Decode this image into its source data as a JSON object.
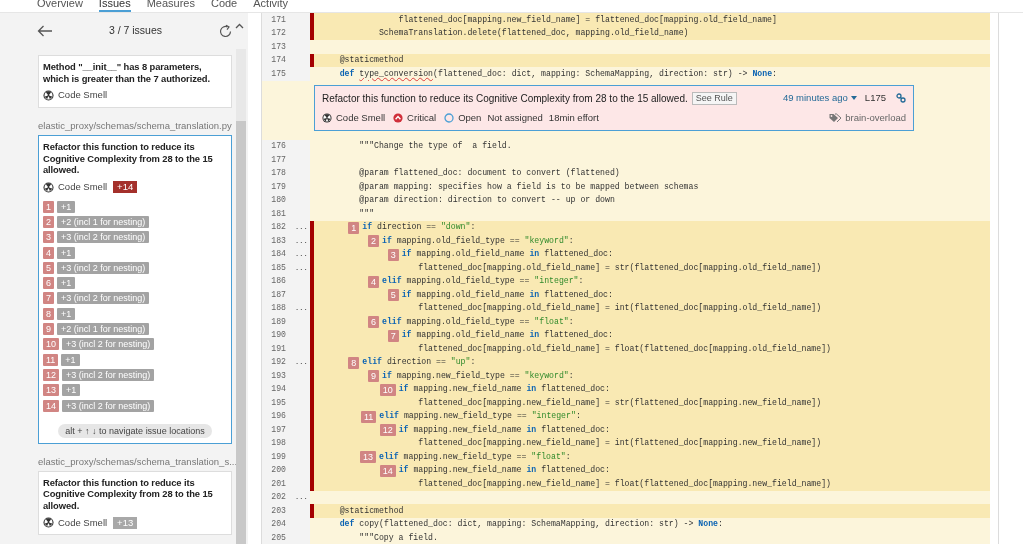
{
  "nav_tabs": [
    {
      "label": "Overview",
      "selected": false
    },
    {
      "label": "Issues",
      "selected": true
    },
    {
      "label": "Measures",
      "selected": false
    },
    {
      "label": "Code",
      "selected": false
    },
    {
      "label": "Activity",
      "selected": false
    }
  ],
  "issues_panel": {
    "counter": "3 / 7 issues",
    "issues": [
      {
        "message": "Method \"__init__\" has 8 parameters, which is greater than the 7 authorized.",
        "type": "Code Smell",
        "selected": false
      },
      {
        "file_path": "elastic_proxy/schemas/schema_translation.py",
        "message": "Refactor this function to reduce its Cognitive Complexity from 28 to the 15 allowed.",
        "type": "Code Smell",
        "selected": true,
        "count": "+14",
        "locations": [
          {
            "index": "1",
            "text": "+1"
          },
          {
            "index": "2",
            "text": "+2 (incl 1 for nesting)"
          },
          {
            "index": "3",
            "text": "+3 (incl 2 for nesting)"
          },
          {
            "index": "4",
            "text": "+1"
          },
          {
            "index": "5",
            "text": "+3 (incl 2 for nesting)"
          },
          {
            "index": "6",
            "text": "+1"
          },
          {
            "index": "7",
            "text": "+3 (incl 2 for nesting)"
          },
          {
            "index": "8",
            "text": "+1"
          },
          {
            "index": "9",
            "text": "+2 (incl 1 for nesting)"
          },
          {
            "index": "10",
            "text": "+3 (incl 2 for nesting)"
          },
          {
            "index": "11",
            "text": "+1"
          },
          {
            "index": "12",
            "text": "+3 (incl 2 for nesting)"
          },
          {
            "index": "13",
            "text": "+1"
          },
          {
            "index": "14",
            "text": "+3 (incl 2 for nesting)"
          }
        ],
        "hint": "alt + ↑ ↓ to navigate issue locations"
      },
      {
        "file_path": "elastic_proxy/schemas/schema_translation_s...",
        "message": "Refactor this function to reduce its Cognitive Complexity from 28 to the 15 allowed.",
        "type": "Code Smell",
        "selected": false,
        "count": "+13"
      }
    ]
  },
  "code": {
    "lines_before": [
      {
        "number": "171",
        "highlighted": true,
        "segments": [
          {
            "kind": "plain",
            "text": "                flattened_doc[mapping.new_field_name] = flattened_doc[mapping.old_field_name]"
          }
        ]
      },
      {
        "number": "172",
        "highlighted": true,
        "segments": [
          {
            "kind": "plain",
            "text": "            SchemaTranslation.delete(flattened_doc, mapping.old_field_name)"
          }
        ]
      },
      {
        "number": "173",
        "highlighted": false
      },
      {
        "number": "174",
        "highlighted": true,
        "segments": [
          {
            "kind": "plain",
            "text": "    @staticmethod"
          }
        ]
      },
      {
        "number": "175",
        "highlighted": false,
        "segments": [
          {
            "kind": "keyword",
            "text": "    def "
          },
          {
            "kind": "flagged",
            "text": "type_conversion"
          },
          {
            "kind": "plain",
            "text": "(flattened_doc: dict, mapping: SchemaMapping, direction: str) -> "
          },
          {
            "kind": "keyword",
            "text": "None"
          },
          {
            "kind": "plain",
            "text": ":"
          }
        ]
      }
    ],
    "issue_box": {
      "message": "Refactor this function to reduce its Cognitive Complexity from 28 to the 15 allowed.",
      "rule_button": "See Rule",
      "age": "49 minutes ago",
      "line": "L175",
      "type": "Code Smell",
      "severity": "Critical",
      "status": "Open",
      "assignee": "Not assigned",
      "effort": "18min effort",
      "tag": "brain-overload"
    },
    "lines_after": [
      {
        "number": "176",
        "highlighted": false,
        "segments": [
          {
            "kind": "plain",
            "text": "        \"\"\"Change the type of  a field."
          }
        ]
      },
      {
        "number": "177",
        "highlighted": false
      },
      {
        "number": "178",
        "highlighted": false,
        "segments": [
          {
            "kind": "plain",
            "text": "        @param flattened_doc: document to convert (flattened)"
          }
        ]
      },
      {
        "number": "179",
        "highlighted": false,
        "segments": [
          {
            "kind": "plain",
            "text": "        @param mapping: specifies how a field is to be mapped between schemas"
          }
        ]
      },
      {
        "number": "180",
        "highlighted": false,
        "segments": [
          {
            "kind": "plain",
            "text": "        @param direction: direction to convert -- up or down"
          }
        ]
      },
      {
        "number": "181",
        "highlighted": false,
        "segments": [
          {
            "kind": "plain",
            "text": "        \"\"\""
          }
        ]
      },
      {
        "number": "182",
        "highlighted": true,
        "gutter_mark": "...",
        "badge": "1",
        "segments": [
          {
            "kind": "keyword",
            "text": "        if"
          },
          {
            "kind": "plain",
            "text": " direction == "
          },
          {
            "kind": "string",
            "text": "\"down\""
          },
          {
            "kind": "plain",
            "text": ":"
          }
        ]
      },
      {
        "number": "183",
        "highlighted": true,
        "gutter_mark": "...",
        "badge": "2",
        "segments": [
          {
            "kind": "keyword",
            "text": "            if"
          },
          {
            "kind": "plain",
            "text": " mapping.old_field_type == "
          },
          {
            "kind": "string",
            "text": "\"keyword\""
          },
          {
            "kind": "plain",
            "text": ":"
          }
        ]
      },
      {
        "number": "184",
        "highlighted": true,
        "gutter_mark": "...",
        "badge": "3",
        "segments": [
          {
            "kind": "keyword",
            "text": "                if"
          },
          {
            "kind": "plain",
            "text": " mapping.old_field_name "
          },
          {
            "kind": "keyword",
            "text": "in"
          },
          {
            "kind": "plain",
            "text": " flattened_doc:"
          }
        ]
      },
      {
        "number": "185",
        "highlighted": true,
        "gutter_mark": "...",
        "segments": [
          {
            "kind": "plain",
            "text": "                    flattened_doc[mapping.old_field_name] = str(flattened_doc[mapping.old_field_name])"
          }
        ]
      },
      {
        "number": "186",
        "highlighted": true,
        "badge": "4",
        "segments": [
          {
            "kind": "keyword",
            "text": "            elif"
          },
          {
            "kind": "plain",
            "text": " mapping.old_field_type == "
          },
          {
            "kind": "string",
            "text": "\"integer\""
          },
          {
            "kind": "plain",
            "text": ":"
          }
        ]
      },
      {
        "number": "187",
        "highlighted": true,
        "badge": "5",
        "segments": [
          {
            "kind": "keyword",
            "text": "                if"
          },
          {
            "kind": "plain",
            "text": " mapping.old_field_name "
          },
          {
            "kind": "keyword",
            "text": "in"
          },
          {
            "kind": "plain",
            "text": " flattened_doc:"
          }
        ]
      },
      {
        "number": "188",
        "highlighted": true,
        "gutter_mark": "...",
        "segments": [
          {
            "kind": "plain",
            "text": "                    flattened_doc[mapping.old_field_name] = int(flattened_doc[mapping.old_field_name])"
          }
        ]
      },
      {
        "number": "189",
        "highlighted": true,
        "badge": "6",
        "segments": [
          {
            "kind": "keyword",
            "text": "            elif"
          },
          {
            "kind": "plain",
            "text": " mapping.old_field_type == "
          },
          {
            "kind": "string",
            "text": "\"float\""
          },
          {
            "kind": "plain",
            "text": ":"
          }
        ]
      },
      {
        "number": "190",
        "highlighted": true,
        "badge": "7",
        "segments": [
          {
            "kind": "keyword",
            "text": "                if"
          },
          {
            "kind": "plain",
            "text": " mapping.old_field_name "
          },
          {
            "kind": "keyword",
            "text": "in"
          },
          {
            "kind": "plain",
            "text": " flattened_doc:"
          }
        ]
      },
      {
        "number": "191",
        "highlighted": true,
        "segments": [
          {
            "kind": "plain",
            "text": "                    flattened_doc[mapping.old_field_name] = float(flattened_doc[mapping.old_field_name])"
          }
        ]
      },
      {
        "number": "192",
        "highlighted": true,
        "gutter_mark": "...",
        "badge": "8",
        "segments": [
          {
            "kind": "keyword",
            "text": "        elif"
          },
          {
            "kind": "plain",
            "text": " direction == "
          },
          {
            "kind": "string",
            "text": "\"up\""
          },
          {
            "kind": "plain",
            "text": ":"
          }
        ]
      },
      {
        "number": "193",
        "highlighted": true,
        "badge": "9",
        "segments": [
          {
            "kind": "keyword",
            "text": "            if"
          },
          {
            "kind": "plain",
            "text": " mapping.new_field_type == "
          },
          {
            "kind": "string",
            "text": "\"keyword\""
          },
          {
            "kind": "plain",
            "text": ":"
          }
        ]
      },
      {
        "number": "194",
        "highlighted": true,
        "badge": "10",
        "segments": [
          {
            "kind": "keyword",
            "text": "                if"
          },
          {
            "kind": "plain",
            "text": " mapping.new_field_name "
          },
          {
            "kind": "keyword",
            "text": "in"
          },
          {
            "kind": "plain",
            "text": " flattened_doc:"
          }
        ]
      },
      {
        "number": "195",
        "highlighted": true,
        "segments": [
          {
            "kind": "plain",
            "text": "                    flattened_doc[mapping.new_field_name] = str(flattened_doc[mapping.new_field_name])"
          }
        ]
      },
      {
        "number": "196",
        "highlighted": true,
        "badge": "11",
        "segments": [
          {
            "kind": "keyword",
            "text": "            elif"
          },
          {
            "kind": "plain",
            "text": " mapping.new_field_type == "
          },
          {
            "kind": "string",
            "text": "\"integer\""
          },
          {
            "kind": "plain",
            "text": ":"
          }
        ]
      },
      {
        "number": "197",
        "highlighted": true,
        "badge": "12",
        "segments": [
          {
            "kind": "keyword",
            "text": "                if"
          },
          {
            "kind": "plain",
            "text": " mapping.new_field_name "
          },
          {
            "kind": "keyword",
            "text": "in"
          },
          {
            "kind": "plain",
            "text": " flattened_doc:"
          }
        ]
      },
      {
        "number": "198",
        "highlighted": true,
        "segments": [
          {
            "kind": "plain",
            "text": "                    flattened_doc[mapping.new_field_name] = int(flattened_doc[mapping.new_field_name])"
          }
        ]
      },
      {
        "number": "199",
        "highlighted": true,
        "badge": "13",
        "segments": [
          {
            "kind": "keyword",
            "text": "            elif"
          },
          {
            "kind": "plain",
            "text": " mapping.new_field_type == "
          },
          {
            "kind": "string",
            "text": "\"float\""
          },
          {
            "kind": "plain",
            "text": ":"
          }
        ]
      },
      {
        "number": "200",
        "highlighted": true,
        "badge": "14",
        "segments": [
          {
            "kind": "keyword",
            "text": "                if"
          },
          {
            "kind": "plain",
            "text": " mapping.new_field_name "
          },
          {
            "kind": "keyword",
            "text": "in"
          },
          {
            "kind": "plain",
            "text": " flattened_doc:"
          }
        ]
      },
      {
        "number": "201",
        "highlighted": true,
        "segments": [
          {
            "kind": "plain",
            "text": "                    flattened_doc[mapping.new_field_name] = float(flattened_doc[mapping.new_field_name])"
          }
        ]
      },
      {
        "number": "202",
        "highlighted": false,
        "gutter_mark": "..."
      },
      {
        "number": "203",
        "highlighted": true,
        "segments": [
          {
            "kind": "plain",
            "text": "    @staticmethod"
          }
        ]
      },
      {
        "number": "204",
        "highlighted": false,
        "segments": [
          {
            "kind": "keyword",
            "text": "    def"
          },
          {
            "kind": "plain",
            "text": " copy(flattened_doc: dict, mapping: SchemaMapping, direction: str) -> "
          },
          {
            "kind": "keyword",
            "text": "None"
          },
          {
            "kind": "plain",
            "text": ":"
          }
        ]
      },
      {
        "number": "205",
        "highlighted": false,
        "segments": [
          {
            "kind": "plain",
            "text": "        \"\"\"Copy a field."
          }
        ]
      }
    ]
  }
}
